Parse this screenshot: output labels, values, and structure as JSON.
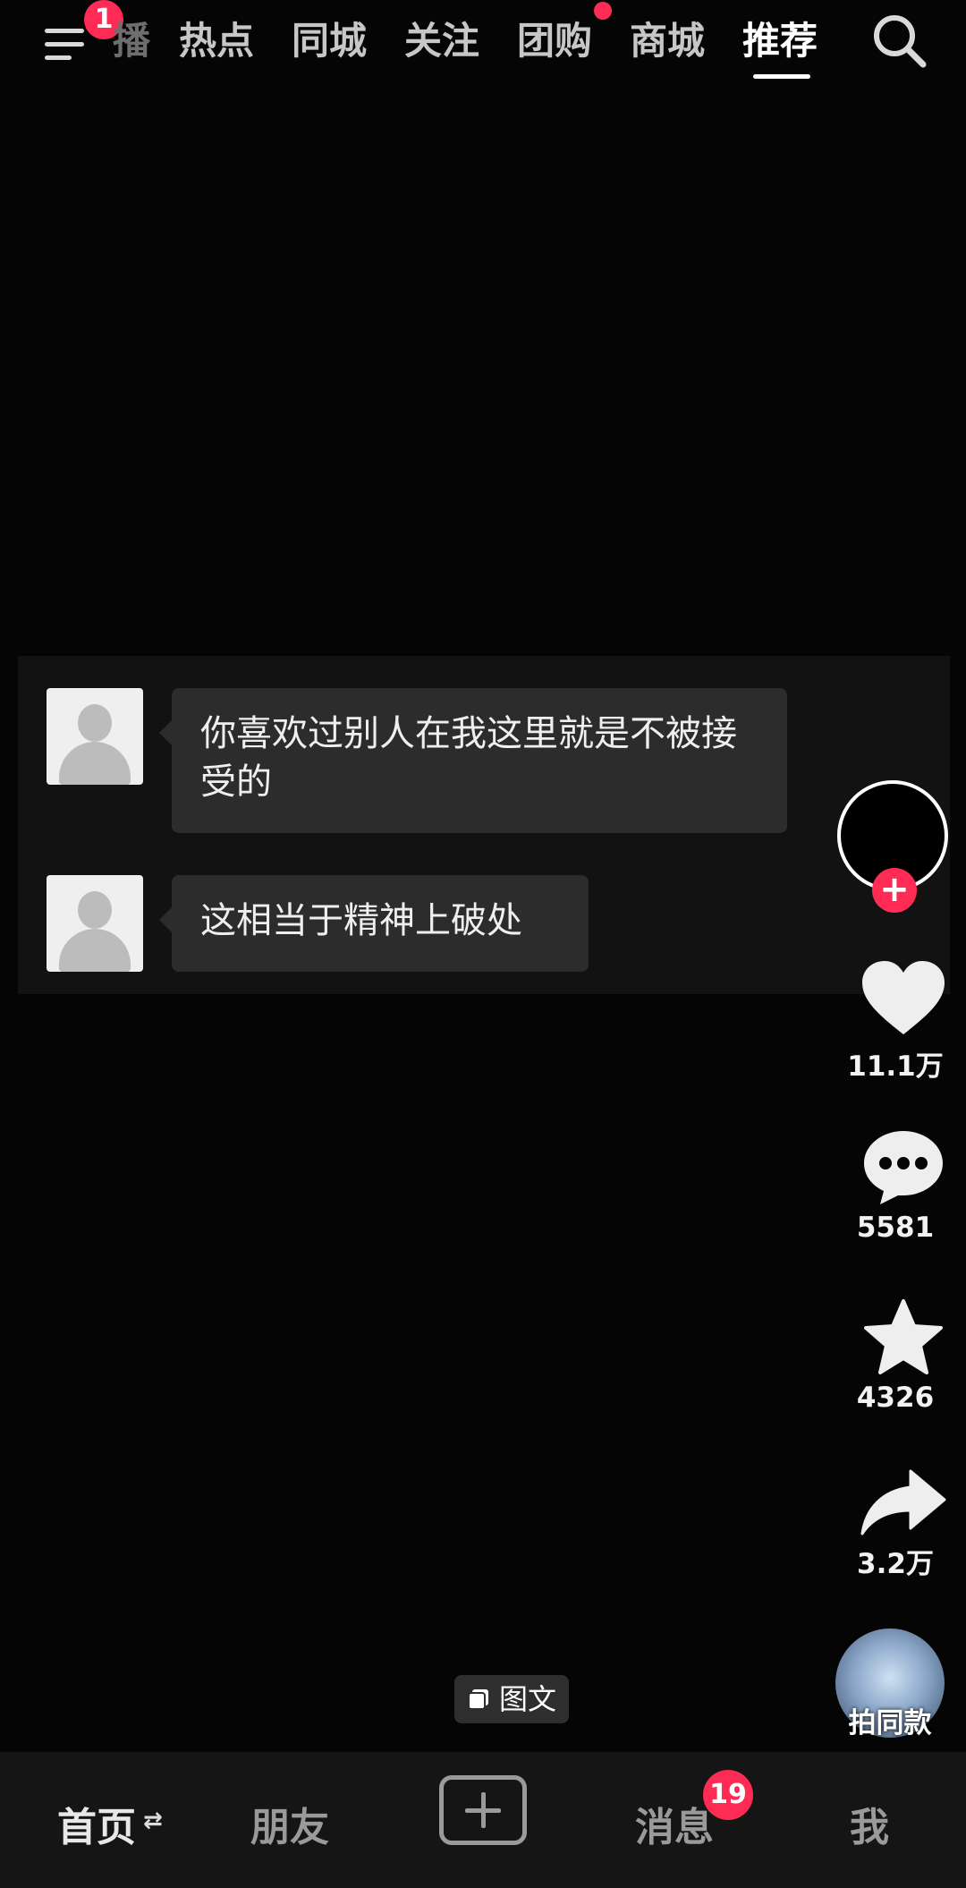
{
  "topbar": {
    "menu_badge": "1",
    "tabs": [
      {
        "label": "播"
      },
      {
        "label": "热点"
      },
      {
        "label": "同城"
      },
      {
        "label": "关注"
      },
      {
        "label": "团购"
      },
      {
        "label": "商城"
      },
      {
        "label": "推荐"
      }
    ],
    "active_tab": "推荐"
  },
  "chat": {
    "messages": [
      {
        "text": "你喜欢过别人在我这里就是不被接受的"
      },
      {
        "text": "这相当于精神上破处"
      }
    ]
  },
  "rail": {
    "likes": "11.1万",
    "comments": "5581",
    "favorites": "4326",
    "shares": "3.2万",
    "music_label": "拍同款"
  },
  "post_type_tag": "图文",
  "bottom_nav": {
    "home": "首页",
    "friends": "朋友",
    "messages": "消息",
    "messages_badge": "19",
    "me": "我"
  },
  "colors": {
    "accent": "#fe2c55",
    "background": "#050505",
    "nav_background": "#151515"
  }
}
